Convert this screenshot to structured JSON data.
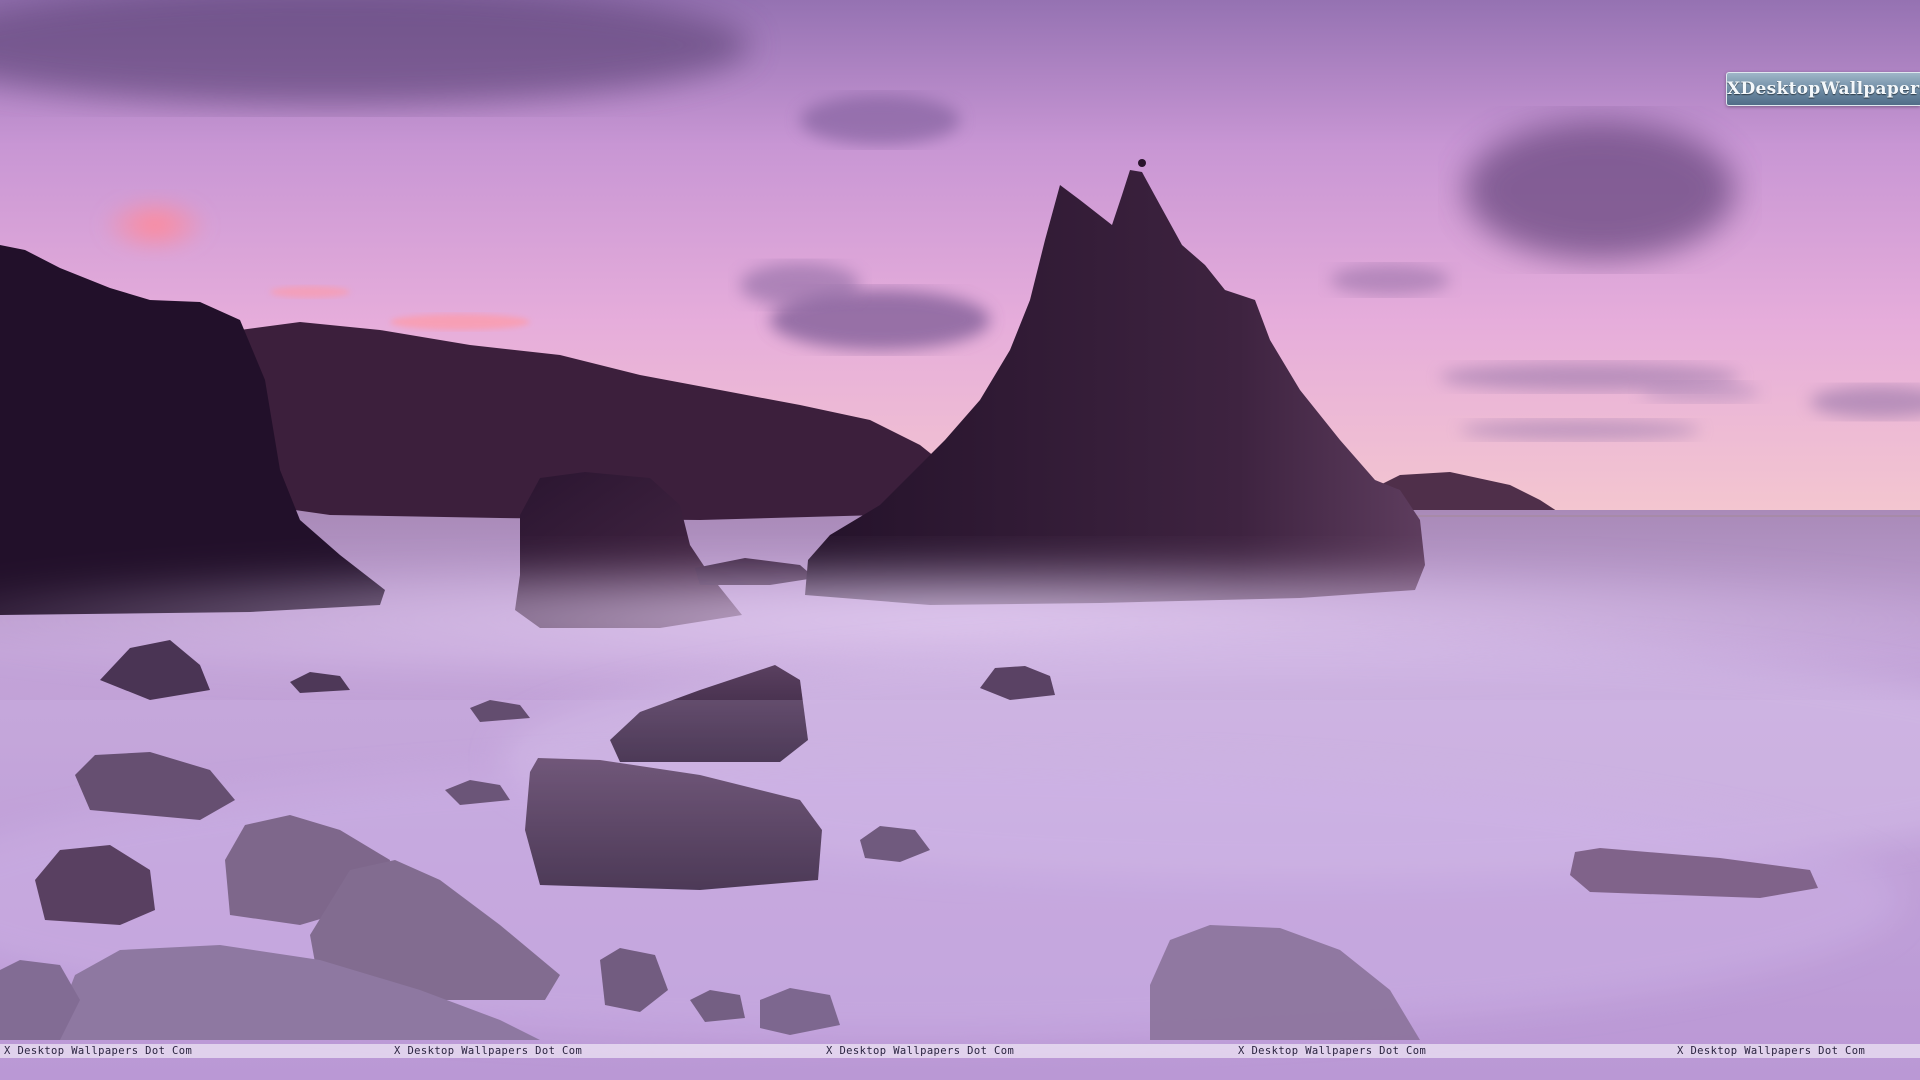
{
  "logo": {
    "text": "XDesktopWallpapers.Com"
  },
  "watermarks": [
    "X Desktop Wallpapers Dot Com",
    "X Desktop Wallpapers Dot Com",
    "X Desktop Wallpapers Dot Com",
    "X Desktop Wallpapers Dot Com",
    "X Desktop Wallpapers Dot Com"
  ],
  "colors": {
    "sky_top": "#9a74b4",
    "sky_mid": "#d6a0d6",
    "horizon_glow": "#f2c2d0",
    "sea_mist": "#c8a8e0",
    "rock_dark": "#2a1630",
    "headland": "#3b2038",
    "logo_badge": "#6d8aa3"
  }
}
